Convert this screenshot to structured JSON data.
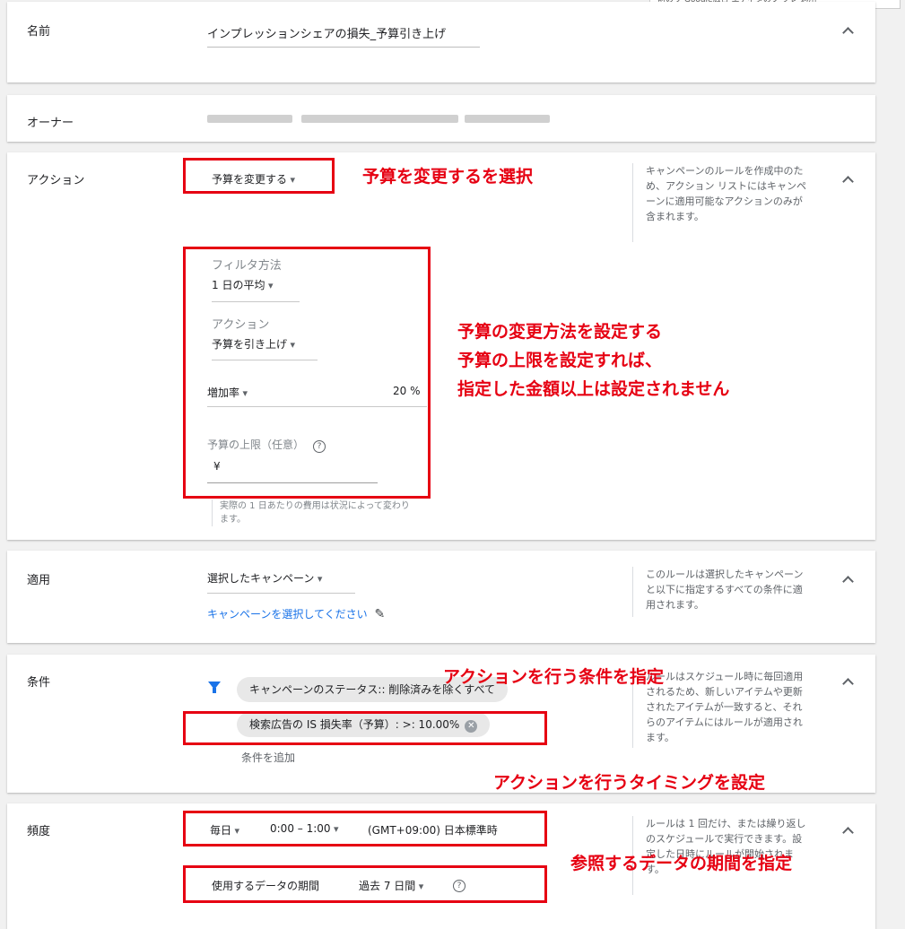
{
  "top_note": "前のリ Google広告 エディタのプ フレ 適用",
  "name": {
    "label": "名前",
    "value": "インプレッションシェアの損失_予算引き上げ"
  },
  "owner": {
    "label": "オーナー"
  },
  "action": {
    "label": "アクション",
    "selected": "予算を変更する",
    "help": "キャンペーンのルールを作成中のため、アクション リストにはキャンペーンに適用可能なアクションのみが含まれます。",
    "filter_label": "フィルタ方法",
    "filter_value": "1 日の平均",
    "action_sub_label": "アクション",
    "action_sub_value": "予算を引き上げ",
    "increase_type": "増加率",
    "increase_value": "20 %",
    "cap_label": "予算の上限（任意）",
    "cap_value": "¥",
    "cap_note": "実際の 1 日あたりの費用は状況によって変わります。"
  },
  "apply": {
    "label": "適用",
    "selected": "選択したキャンペーン",
    "link": "キャンペーンを選択してください",
    "help": "このルールは選択したキャンペーンと以下に指定するすべての条件に適用されます。"
  },
  "conditions": {
    "label": "条件",
    "chip1": "キャンペーンのステータス:: 削除済みを除くすべて",
    "chip2": "検索広告の IS 損失率（予算）: >: 10.00%",
    "add": "条件を追加",
    "help": "ルールはスケジュール時に毎回適用されるため、新しいアイテムや更新されたアイテムが一致すると、それらのアイテムにはルールが適用されます。"
  },
  "frequency": {
    "label": "頻度",
    "day": "毎日",
    "time": "0:00 – 1:00",
    "tz": "(GMT+09:00) 日本標準時",
    "period_label": "使用するデータの期間",
    "period_value": "過去 7 日間",
    "help": "ルールは 1 回だけ、または繰り返しのスケジュールで実行できます。設定した日時にルールが開始されます。"
  },
  "annotations": {
    "a1": "予算を変更するを選択",
    "a2_l1": "予算の変更方法を設定する",
    "a2_l2": "予算の上限を設定すれば、",
    "a2_l3": "指定した金額以上は設定されません",
    "a3": "アクションを行う条件を指定",
    "a4": "アクションを行うタイミングを設定",
    "a5": "参照するデータの期間を指定"
  },
  "colors": {
    "annotation_red": "#e60012",
    "link_blue": "#1a73e8",
    "filter_icon_blue": "#1a73e8"
  }
}
